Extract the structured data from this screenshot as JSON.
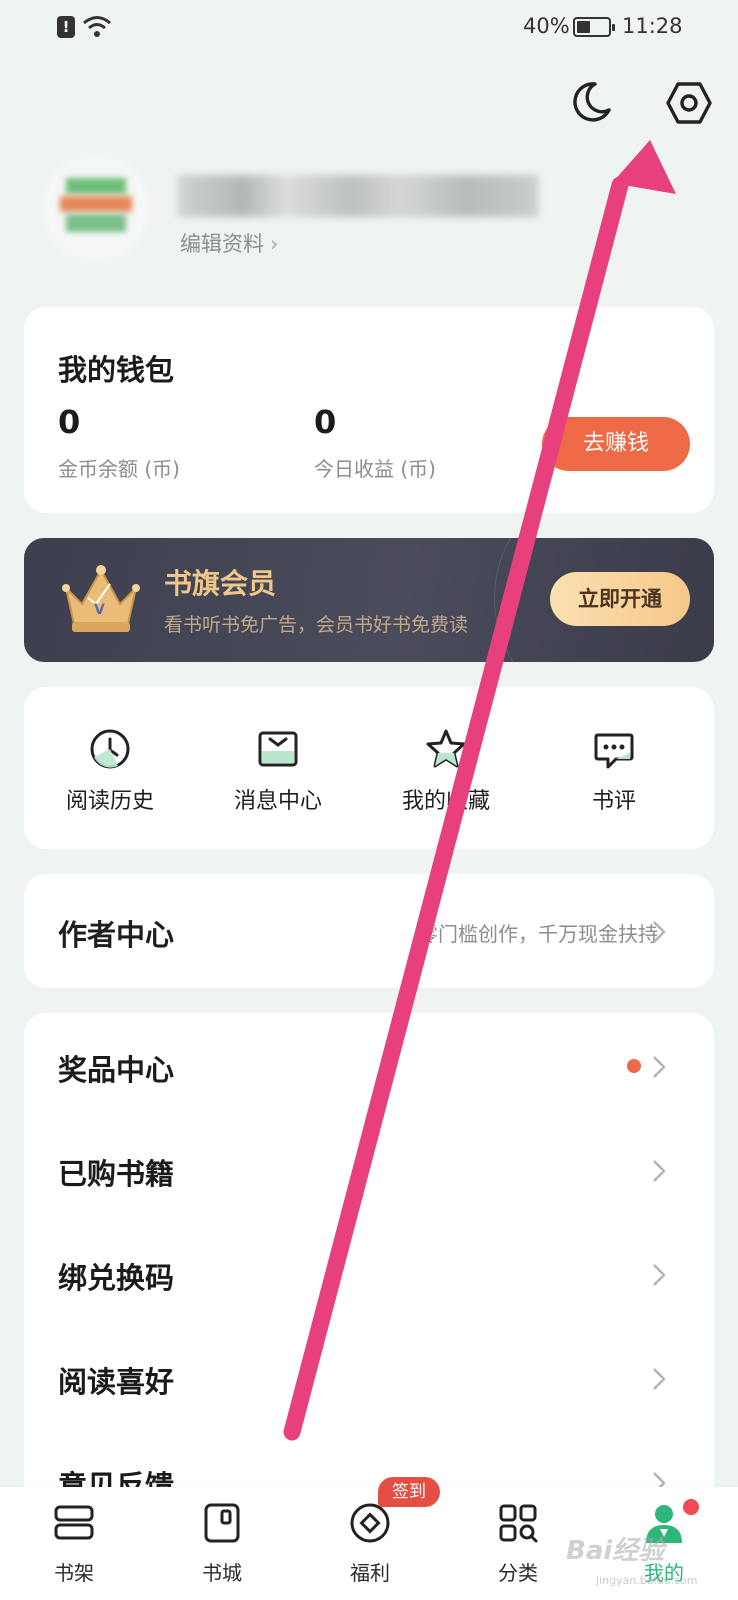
{
  "status_bar": {
    "battery": "40%",
    "time": "11:28",
    "alert_glyph": "!",
    "icons": [
      "alert-icon",
      "wifi-icon",
      "battery-icon"
    ]
  },
  "header": {
    "icons": [
      "moon-icon",
      "settings-gear-icon"
    ]
  },
  "profile": {
    "edit_label": "编辑资料",
    "chevron": "›"
  },
  "wallet": {
    "title": "我的钱包",
    "coins_value": "0",
    "coins_label": "金币余额 (币)",
    "today_value": "0",
    "today_label": "今日收益 (币)",
    "earn_button": "去赚钱",
    "accent_color": "#ee6a46"
  },
  "vip": {
    "title": "书旗会员",
    "description": "看书听书免广告，会员书好书免费读",
    "button": "立即开通",
    "crown_letter": "V"
  },
  "quick_actions": [
    {
      "label": "阅读历史",
      "icon": "clock-icon"
    },
    {
      "label": "消息中心",
      "icon": "message-icon"
    },
    {
      "label": "我的收藏",
      "icon": "star-icon"
    },
    {
      "label": "书评",
      "icon": "comment-icon"
    }
  ],
  "author_center": {
    "title": "作者中心",
    "description": "零门槛创作，千万现金扶持"
  },
  "menu": [
    {
      "label": "奖品中心",
      "has_dot": true
    },
    {
      "label": "已购书籍",
      "has_dot": false
    },
    {
      "label": "绑兑换码",
      "has_dot": false
    },
    {
      "label": "阅读喜好",
      "has_dot": false
    },
    {
      "label": "意见反馈",
      "has_dot": false
    }
  ],
  "tabbar": {
    "tabs": [
      {
        "label": "书架",
        "icon": "bookshelf-icon"
      },
      {
        "label": "书城",
        "icon": "bookstore-icon"
      },
      {
        "label": "福利",
        "icon": "coin-icon"
      },
      {
        "label": "分类",
        "icon": "category-grid-icon"
      },
      {
        "label": "我的",
        "icon": "profile-icon",
        "active": true
      }
    ],
    "checkin_badge": "签到",
    "active_color": "#2fb67a"
  },
  "watermark": {
    "text": "Bai经验",
    "sub": "jingyan.baidu.com"
  },
  "annotation": {
    "color": "#e8407d"
  }
}
